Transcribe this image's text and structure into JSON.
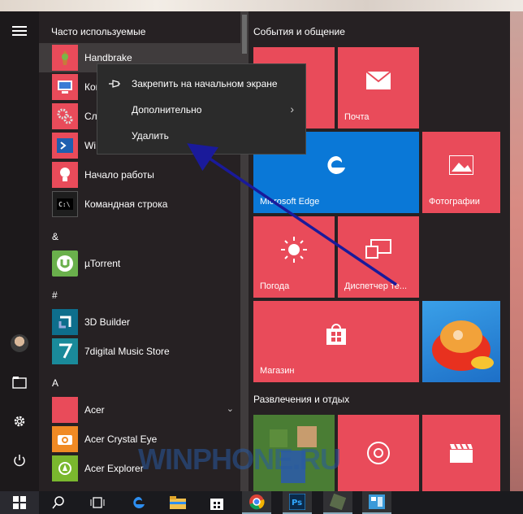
{
  "app_list": {
    "most_used_header": "Часто используемые",
    "items": [
      {
        "label": "Handbrake",
        "color": "#e94b5a"
      },
      {
        "label": "Ком",
        "color": "#e94b5a"
      },
      {
        "label": "Слу",
        "color": "#e94b5a"
      },
      {
        "label": "Wi",
        "color": "#e94b5a"
      },
      {
        "label": "Начало работы",
        "color": "#e94b5a"
      },
      {
        "label": "Командная строка",
        "color": "#1e1e1e"
      }
    ],
    "section_amp": "&",
    "utorrent": "µTorrent",
    "section_hash": "#",
    "builder": "3D Builder",
    "digital": "7digital Music Store",
    "section_a": "A",
    "acer": "Acer",
    "acer_crystal": "Acer Crystal Eye",
    "acer_explorer": "Acer Explorer"
  },
  "context_menu": {
    "pin": "Закрепить на начальном экране",
    "more": "Дополнительно",
    "uninstall": "Удалить"
  },
  "tiles": {
    "group1": "События и общение",
    "mail": "Почта",
    "edge": "Microsoft Edge",
    "photos": "Фотографии",
    "weather": "Погода",
    "taskmgr": "Диспетчер те...",
    "store": "Магазин",
    "group2": "Развлечения и отдых"
  },
  "watermark": "WINPHONE.RU",
  "colors": {
    "accent": "#e94b5a",
    "edge_blue": "#0a78d7",
    "arrow": "#1a1a9a"
  }
}
